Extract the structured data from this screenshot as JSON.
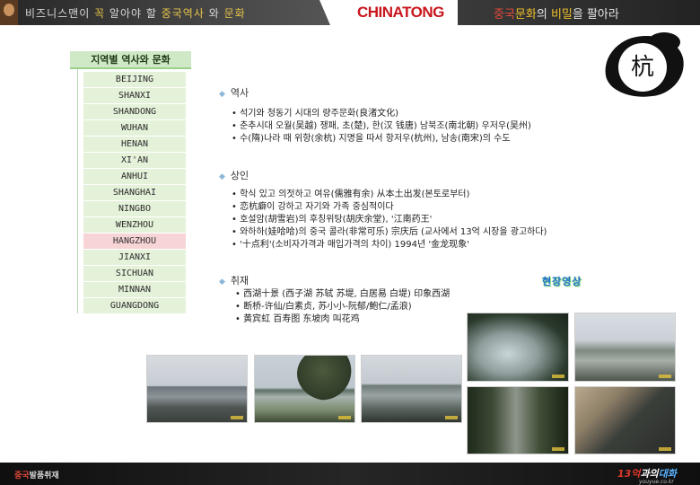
{
  "header": {
    "left_tagline_a": "비즈니스맨이 ",
    "left_tagline_b": "꼭",
    "left_tagline_c": " 알아야 할 ",
    "left_tagline_d": "중국역사",
    "left_tagline_e": " 와 ",
    "left_tagline_f": "문화",
    "logo": "CHINATONG",
    "right_tagline_a": "중국",
    "right_tagline_b": "문화",
    "right_tagline_c": "의 ",
    "right_tagline_d": "비밀",
    "right_tagline_e": "을 팔아라"
  },
  "sidebar": {
    "title": "지역별 역사와 문화",
    "items": [
      {
        "label": "BEIJING"
      },
      {
        "label": "SHANXI"
      },
      {
        "label": "SHANDONG"
      },
      {
        "label": "WUHAN"
      },
      {
        "label": "HENAN"
      },
      {
        "label": "XI'AN"
      },
      {
        "label": "ANHUI"
      },
      {
        "label": "SHANGHAI"
      },
      {
        "label": "NINGBO"
      },
      {
        "label": "WENZHOU"
      },
      {
        "label": "HANGZHOU"
      },
      {
        "label": "JIANXI"
      },
      {
        "label": "SICHUAN"
      },
      {
        "label": "MINNAN"
      },
      {
        "label": "GUANGDONG"
      }
    ],
    "active_label": "HANGZHOU"
  },
  "seal": {
    "char": "杭"
  },
  "sections": {
    "history": {
      "title": "역사",
      "lines": [
        "석기와 청동기 시대의 량주문화(良渚文化)",
        "춘추시대 오월(吴越) 쟁패, 초(楚), 한(汉 钱唐) 남북조(南北朝) 우저우(吴州)",
        "수(隋)나라 때 위항(余杭) 지명을 따서 항저우(杭州), 남송(南宋)의 수도"
      ]
    },
    "merchants": {
      "title": "상인",
      "lines": [
        "학식 있고 의젓하고 여유(儒雅有余) 从本土出发(본토로부터)",
        "恋杭癖이 강하고 자기와 가족 중심적이다",
        "호설암(胡雪岩)의 후칭위탕(胡庆余堂), '江南药王'",
        "와하하(娃哈哈)의 중국 콜라(非常可乐) 宗庆后 (교사에서 13억 시장을 광고하다)",
        "'十点利'(소비자가격과 매입가격의 차이) 1994년 '金龙现象'"
      ]
    },
    "interview": {
      "title": "취재",
      "lines": [
        "西湖十景 (西子湖 苏轼 苏堤, 白居易 白堤) 印象西湖",
        "断桥-许仙/白素贞, 苏小小-阮郁/鮑仁/孟浪)",
        "黄宾虹 百寿图 东坡肉 叫花鸡"
      ]
    }
  },
  "video_label": "현장영상",
  "photos": [
    {
      "name": "lakeside-people"
    },
    {
      "name": "willow-lake"
    },
    {
      "name": "lake-promenade"
    },
    {
      "name": "lotus-pond"
    },
    {
      "name": "pagoda-shore"
    },
    {
      "name": "tree-lined-path"
    },
    {
      "name": "statue-closeup"
    }
  ],
  "footer": {
    "left_a": "중국",
    "left_b": "발품취재",
    "brand_num": "13억",
    "brand_mid": "과의",
    "brand_end": "대화",
    "url": "youyue.co.kr"
  },
  "colors": {
    "sidebar_item_bg": "#e5f2da",
    "sidebar_active_bg": "#f7d4d6",
    "sidebar_title_bg": "#cfe8c6",
    "logo_red": "#c8161d",
    "bullet_blue": "#8cb7d8"
  }
}
